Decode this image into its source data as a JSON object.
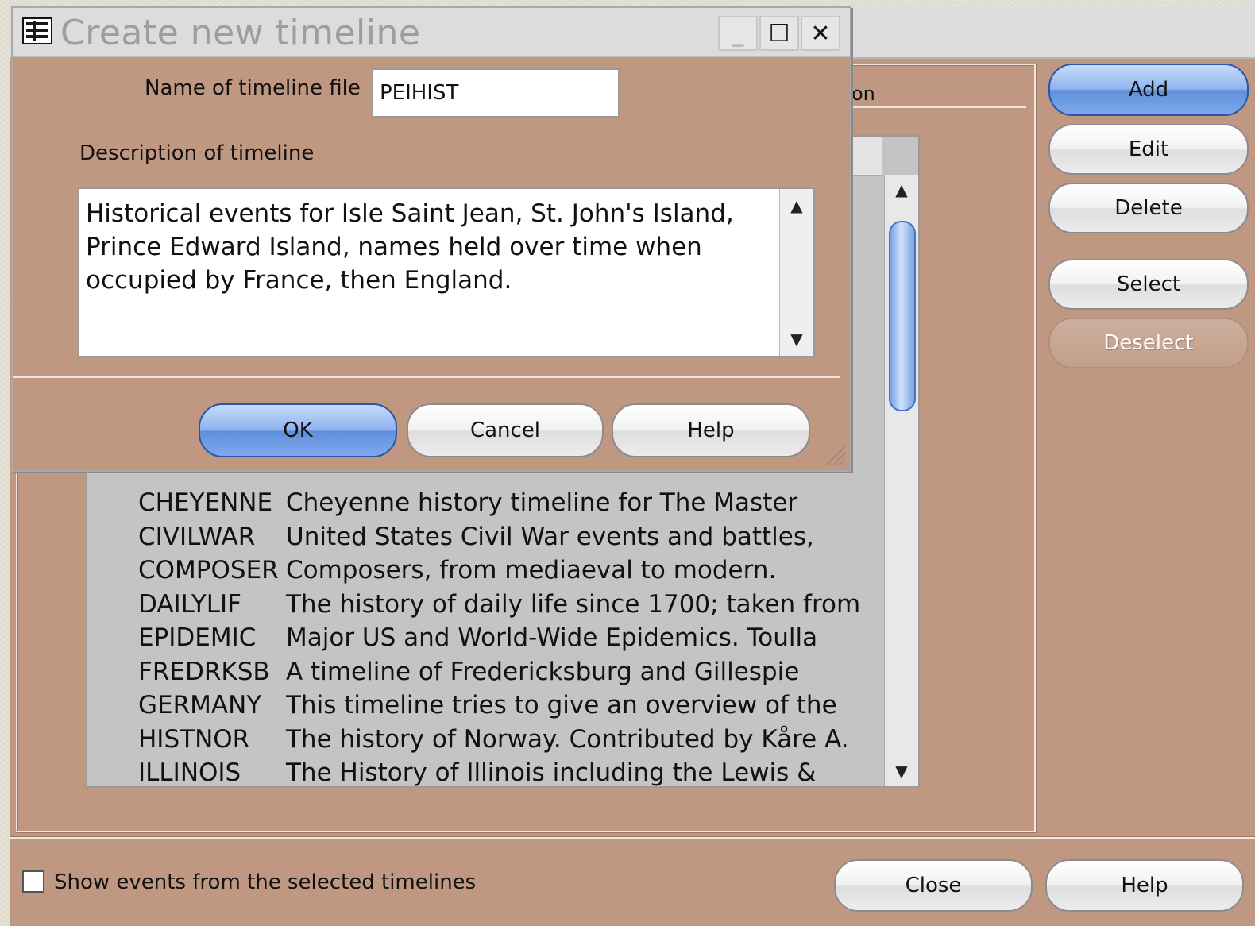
{
  "background_window": {
    "partial_header": "on",
    "timelines": [
      {
        "code": "CHEYENNE",
        "description": "Cheyenne history timeline for The Master"
      },
      {
        "code": "CIVILWAR",
        "description": "United States Civil War events and battles,"
      },
      {
        "code": "COMPOSER",
        "description": "Composers, from mediaeval to modern."
      },
      {
        "code": "DAILYLIF",
        "description": "The history of daily life since 1700; taken from"
      },
      {
        "code": "EPIDEMIC",
        "description": "Major US and World-Wide Epidemics.  Toulla"
      },
      {
        "code": "FREDRKSB",
        "description": "A timeline of Fredericksburg and Gillespie"
      },
      {
        "code": "GERMANY",
        "description": "This timeline tries to give an overview of the"
      },
      {
        "code": "HISTNOR",
        "description": "The history of Norway. Contributed by Kåre A."
      },
      {
        "code": "ILLINOIS",
        "description": "The History of Illinois including the Lewis &"
      }
    ],
    "buttons": {
      "add": "Add",
      "edit": "Edit",
      "delete": "Delete",
      "select": "Select",
      "deselect": "Deselect",
      "close": "Close",
      "help": "Help"
    },
    "show_events_label": "Show events from the selected timelines",
    "show_events_checked": false
  },
  "dialog": {
    "title": "Create new timeline",
    "icon": "table-icon",
    "name_label": "Name of timeline file",
    "name_value": "PEIHIST",
    "description_label": "Description of timeline",
    "description_value": "Historical events for Isle Saint Jean, St. John's Island, Prince Edward Island, names held over time when occupied by France, then England.",
    "buttons": {
      "ok": "OK",
      "cancel": "Cancel",
      "help": "Help"
    },
    "title_buttons": {
      "minimize": "_",
      "maximize": "☐",
      "close": "✕"
    }
  },
  "colors": {
    "window_bg": "#c09882",
    "titlebar": "#dcdcdc",
    "list_bg": "#c4c4c4",
    "primary_button": "#5f8fdc"
  }
}
